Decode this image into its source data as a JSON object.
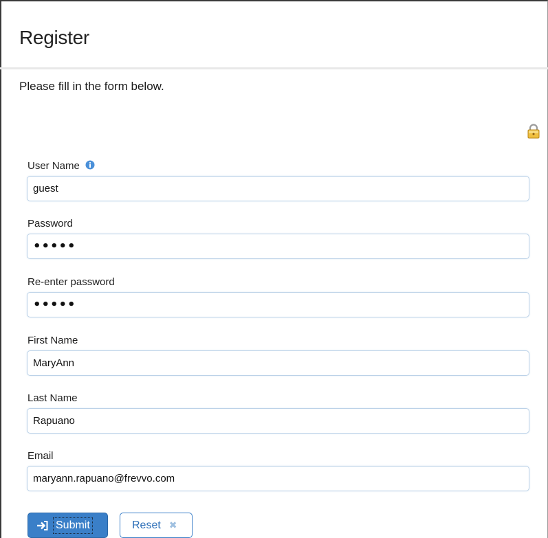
{
  "page": {
    "title": "Register",
    "subtitle": "Please fill in the form below."
  },
  "form": {
    "fields": [
      {
        "label": "User Name",
        "value": "guest",
        "has_info": true
      },
      {
        "label": "Password",
        "value": "•••••"
      },
      {
        "label": "Re-enter password",
        "value": "•••••"
      },
      {
        "label": "First Name",
        "value": "MaryAnn"
      },
      {
        "label": "Last Name",
        "value": "Rapuano"
      },
      {
        "label": "Email",
        "value": "maryann.rapuano@frevvo.com"
      }
    ]
  },
  "buttons": {
    "submit_label": "Submit",
    "reset_label": "Reset",
    "reset_icon": "✖"
  },
  "icons": {
    "lock": "lock-icon",
    "info": "info-icon",
    "submit": "sign-in-icon",
    "reset": "close-icon"
  },
  "colors": {
    "accent": "#3a7fc8",
    "input_border": "#bcd2e8",
    "lock": "#e8b830",
    "info": "#4a90d9"
  }
}
